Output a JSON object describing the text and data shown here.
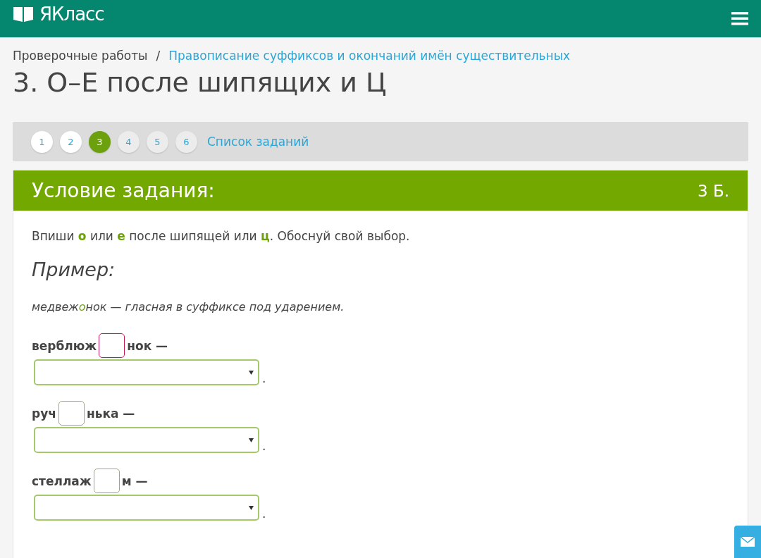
{
  "header": {
    "logo": "ЯКласс"
  },
  "breadcrumbs": [
    {
      "label": "Проверочные работы",
      "link": false
    },
    {
      "label": "/",
      "link": false
    },
    {
      "label": "Правописание суффиксов и окончаний имён существительных",
      "link": true
    }
  ],
  "title": "3. О–Е после шипящих и Ц",
  "task_nav": {
    "items": [
      {
        "label": "1",
        "selected": false,
        "visited": true
      },
      {
        "label": "2",
        "selected": false,
        "visited": true
      },
      {
        "label": "3",
        "selected": true,
        "visited": true
      },
      {
        "label": "4",
        "selected": false,
        "visited": false
      },
      {
        "label": "5",
        "selected": false,
        "visited": false
      },
      {
        "label": "6",
        "selected": false,
        "visited": false
      }
    ],
    "list_link": "Список заданий"
  },
  "card": {
    "heading": "Условие задания:",
    "points": "3 Б.",
    "instruction": "Впиши **о** или **е** после шипящей или **ц**. Обоснуй свой выбор.",
    "example_heading": "Пример:",
    "example": "медвеж**о**нок — гласная в суффиксе под ударением.",
    "tasks": [
      {
        "prefix": "верблюж",
        "suffix": "нок —",
        "focused": true,
        "end": "."
      },
      {
        "prefix": "руч",
        "suffix": "нька —",
        "focused": false,
        "end": "."
      },
      {
        "prefix": "стеллаж",
        "suffix": "м —",
        "focused": false,
        "end": "."
      }
    ]
  }
}
